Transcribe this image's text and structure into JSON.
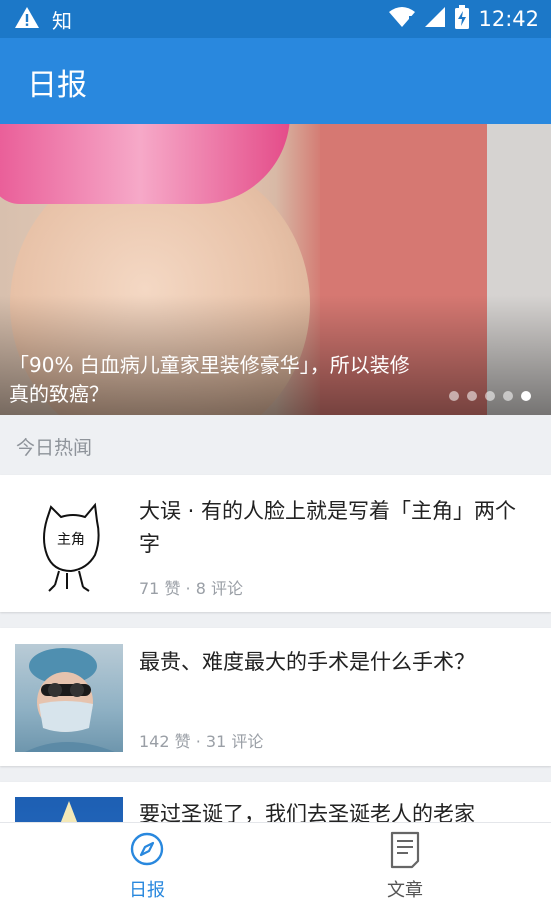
{
  "statusbar": {
    "app_label": "知",
    "time": "12:42",
    "icons": [
      "warning-icon",
      "wifi-icon",
      "signal-icon",
      "battery-charging-icon"
    ]
  },
  "appbar": {
    "title": "日报"
  },
  "banner": {
    "caption": "「90% 白血病儿童家里装修豪华」，所以装修真的致癌？",
    "dots_total": 5,
    "active_dot": 5
  },
  "section": {
    "label": "今日热闻"
  },
  "feed": [
    {
      "title": "大误 · 有的人脸上就是写着「主角」两个字",
      "meta": "71 赞 · 8 评论",
      "thumb_text": "主角"
    },
    {
      "title": "最贵、难度最大的手术是什么手术？",
      "meta": "142 赞 · 31 评论"
    },
    {
      "title": "要过圣诞了，我们去圣诞老人的老家"
    }
  ],
  "tabs": [
    {
      "label": "日报",
      "icon": "compass-icon",
      "active": true
    },
    {
      "label": "文章",
      "icon": "document-icon",
      "active": false
    }
  ],
  "colors": {
    "statusbar": "#1c78c8",
    "appbar": "#2988de",
    "accent": "#2988de",
    "tab_inactive": "#666666"
  }
}
